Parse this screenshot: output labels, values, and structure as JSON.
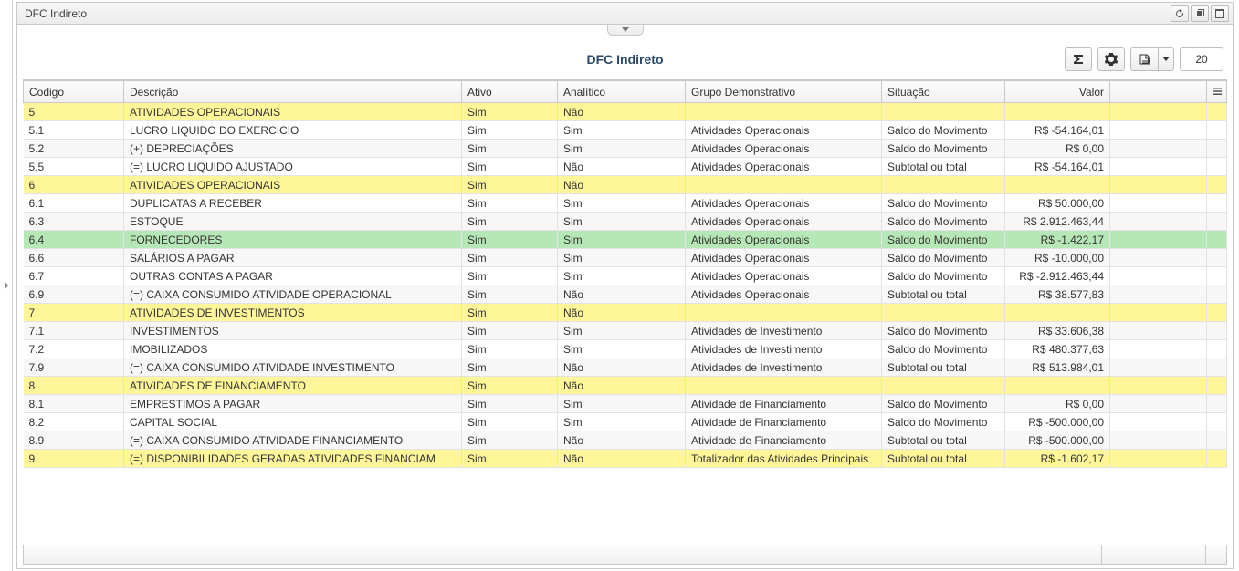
{
  "window": {
    "title": "DFC Indireto"
  },
  "report": {
    "title": "DFC Indireto"
  },
  "toolbar": {
    "page_size": "20"
  },
  "columns": {
    "codigo": "Codigo",
    "descricao": "Descrição",
    "ativo": "Ativo",
    "analitico": "Analítico",
    "grupo": "Grupo Demonstrativo",
    "situacao": "Situação",
    "valor": "Valor"
  },
  "rows": [
    {
      "style": "yellow",
      "codigo": "5",
      "descricao": "ATIVIDADES OPERACIONAIS",
      "ativo": "Sim",
      "analitico": "Não",
      "grupo": "",
      "situacao": "",
      "valor": ""
    },
    {
      "style": "even",
      "codigo": "5.1",
      "descricao": "LUCRO LIQUIDO DO EXERCICIO",
      "ativo": "Sim",
      "analitico": "Sim",
      "grupo": "Atividades Operacionais",
      "situacao": "Saldo do Movimento",
      "valor": "R$ -54.164,01"
    },
    {
      "style": "odd",
      "codigo": "5.2",
      "descricao": "(+) DEPRECIAÇÕES",
      "ativo": "Sim",
      "analitico": "Sim",
      "grupo": "Atividades Operacionais",
      "situacao": "Saldo do Movimento",
      "valor": "R$ 0,00"
    },
    {
      "style": "even",
      "codigo": "5.5",
      "descricao": "(=) LUCRO LIQUIDO AJUSTADO",
      "ativo": "Sim",
      "analitico": "Não",
      "grupo": "Atividades Operacionais",
      "situacao": "Subtotal ou total",
      "valor": "R$ -54.164,01"
    },
    {
      "style": "yellow",
      "codigo": "6",
      "descricao": "ATIVIDADES OPERACIONAIS",
      "ativo": "Sim",
      "analitico": "Não",
      "grupo": "",
      "situacao": "",
      "valor": ""
    },
    {
      "style": "even",
      "codigo": "6.1",
      "descricao": "DUPLICATAS A RECEBER",
      "ativo": "Sim",
      "analitico": "Sim",
      "grupo": "Atividades Operacionais",
      "situacao": "Saldo do Movimento",
      "valor": "R$ 50.000,00"
    },
    {
      "style": "odd",
      "codigo": "6.3",
      "descricao": "ESTOQUE",
      "ativo": "Sim",
      "analitico": "Sim",
      "grupo": "Atividades Operacionais",
      "situacao": "Saldo do Movimento",
      "valor": "R$ 2.912.463,44"
    },
    {
      "style": "green",
      "codigo": "6.4",
      "descricao": "FORNECEDORES",
      "ativo": "Sim",
      "analitico": "Sim",
      "grupo": "Atividades Operacionais",
      "situacao": "Saldo do Movimento",
      "valor": "R$ -1.422,17"
    },
    {
      "style": "odd",
      "codigo": "6.6",
      "descricao": "SALÁRIOS A PAGAR",
      "ativo": "Sim",
      "analitico": "Sim",
      "grupo": "Atividades Operacionais",
      "situacao": "Saldo do Movimento",
      "valor": "R$ -10.000,00"
    },
    {
      "style": "even",
      "codigo": "6.7",
      "descricao": "OUTRAS CONTAS A PAGAR",
      "ativo": "Sim",
      "analitico": "Sim",
      "grupo": "Atividades Operacionais",
      "situacao": "Saldo do Movimento",
      "valor": "R$ -2.912.463,44"
    },
    {
      "style": "odd",
      "codigo": "6.9",
      "descricao": "(=) CAIXA CONSUMIDO ATIVIDADE OPERACIONAL",
      "ativo": "Sim",
      "analitico": "Não",
      "grupo": "Atividades Operacionais",
      "situacao": "Subtotal ou total",
      "valor": "R$ 38.577,83"
    },
    {
      "style": "yellow",
      "codigo": "7",
      "descricao": "ATIVIDADES DE INVESTIMENTOS",
      "ativo": "Sim",
      "analitico": "Não",
      "grupo": "",
      "situacao": "",
      "valor": ""
    },
    {
      "style": "odd",
      "codigo": "7.1",
      "descricao": "INVESTIMENTOS",
      "ativo": "Sim",
      "analitico": "Sim",
      "grupo": "Atividades de Investimento",
      "situacao": "Saldo do Movimento",
      "valor": "R$ 33.606,38"
    },
    {
      "style": "even",
      "codigo": "7.2",
      "descricao": "IMOBILIZADOS",
      "ativo": "Sim",
      "analitico": "Sim",
      "grupo": "Atividades de Investimento",
      "situacao": "Saldo do Movimento",
      "valor": "R$ 480.377,63"
    },
    {
      "style": "odd",
      "codigo": "7.9",
      "descricao": "(=) CAIXA CONSUMIDO ATIVIDADE INVESTIMENTO",
      "ativo": "Sim",
      "analitico": "Não",
      "grupo": "Atividades de Investimento",
      "situacao": "Subtotal ou total",
      "valor": "R$ 513.984,01"
    },
    {
      "style": "yellow",
      "codigo": "8",
      "descricao": "ATIVIDADES DE FINANCIAMENTO",
      "ativo": "Sim",
      "analitico": "Não",
      "grupo": "",
      "situacao": "",
      "valor": ""
    },
    {
      "style": "odd",
      "codigo": "8.1",
      "descricao": "EMPRESTIMOS A PAGAR",
      "ativo": "Sim",
      "analitico": "Sim",
      "grupo": "Atividade de Financiamento",
      "situacao": "Saldo do Movimento",
      "valor": "R$ 0,00"
    },
    {
      "style": "even",
      "codigo": "8.2",
      "descricao": "CAPITAL SOCIAL",
      "ativo": "Sim",
      "analitico": "Sim",
      "grupo": "Atividade de Financiamento",
      "situacao": "Saldo do Movimento",
      "valor": "R$ -500.000,00"
    },
    {
      "style": "odd",
      "codigo": "8.9",
      "descricao": "(=) CAIXA CONSUMIDO ATIVIDADE FINANCIAMENTO",
      "ativo": "Sim",
      "analitico": "Não",
      "grupo": "Atividade de Financiamento",
      "situacao": "Subtotal ou total",
      "valor": "R$ -500.000,00"
    },
    {
      "style": "yellow",
      "codigo": "9",
      "descricao": "(=) DISPONIBILIDADES GERADAS ATIVIDADES FINANCIAM",
      "ativo": "Sim",
      "analitico": "Não",
      "grupo": "Totalizador das Atividades Principais",
      "situacao": "Subtotal ou total",
      "valor": "R$ -1.602,17"
    }
  ]
}
